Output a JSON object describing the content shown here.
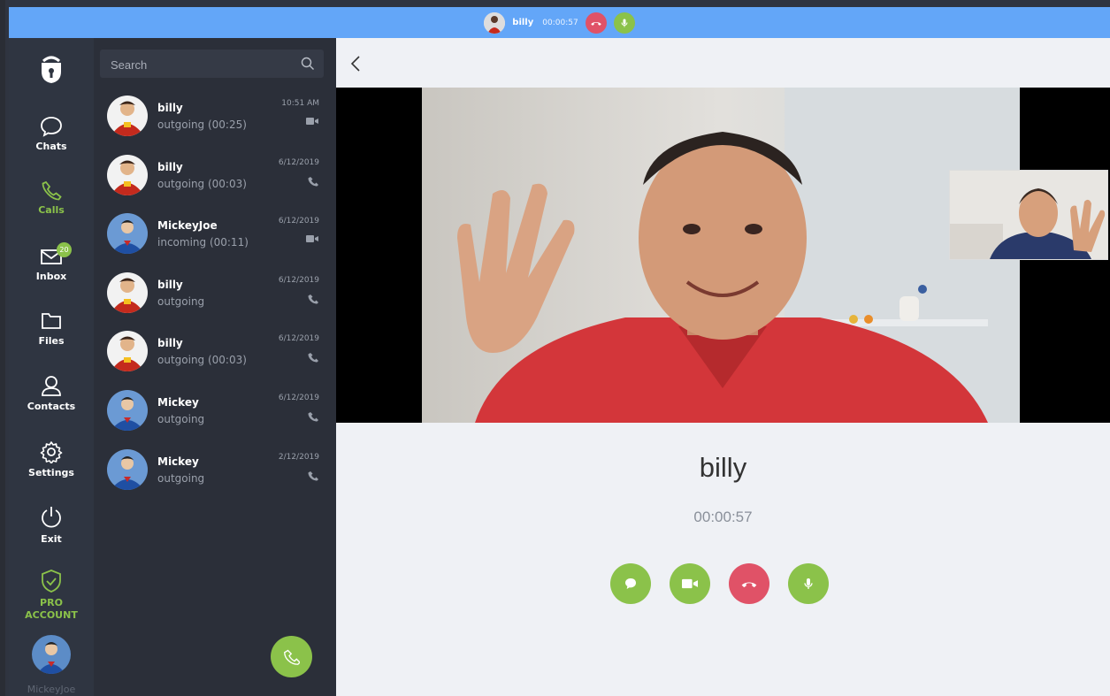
{
  "topbar": {
    "caller_name": "billy",
    "duration": "00:00:57",
    "colors": {
      "bar": "#63a6f8",
      "hangup": "#e05267",
      "mic": "#8bc24a"
    }
  },
  "nav": {
    "items": [
      {
        "label": "Chats",
        "icon": "chat-bubble-icon"
      },
      {
        "label": "Calls",
        "icon": "phone-icon",
        "active": true
      },
      {
        "label": "Inbox",
        "icon": "envelope-icon",
        "badge": "20"
      },
      {
        "label": "Files",
        "icon": "folder-icon"
      },
      {
        "label": "Contacts",
        "icon": "person-icon"
      },
      {
        "label": "Settings",
        "icon": "gear-icon"
      },
      {
        "label": "Exit",
        "icon": "power-icon"
      }
    ],
    "pro_line1": "PRO",
    "pro_line2": "ACCOUNT",
    "user_name": "MickeyJoe"
  },
  "search": {
    "placeholder": "Search"
  },
  "calls": [
    {
      "name": "billy",
      "status": "outgoing (00:25)",
      "date": "10:51 AM",
      "type": "video",
      "avatar": "red-hero"
    },
    {
      "name": "billy",
      "status": "outgoing (00:03)",
      "date": "6/12/2019",
      "type": "voice",
      "avatar": "red-hero"
    },
    {
      "name": "MickeyJoe",
      "status": "incoming (00:11)",
      "date": "6/12/2019",
      "type": "video",
      "avatar": "blue-hero"
    },
    {
      "name": "billy",
      "status": "outgoing",
      "date": "6/12/2019",
      "type": "voice",
      "avatar": "red-hero"
    },
    {
      "name": "billy",
      "status": "outgoing (00:03)",
      "date": "6/12/2019",
      "type": "voice",
      "avatar": "red-hero"
    },
    {
      "name": "Mickey",
      "status": "outgoing",
      "date": "6/12/2019",
      "type": "voice",
      "avatar": "blue-hero"
    },
    {
      "name": "Mickey",
      "status": "outgoing",
      "date": "2/12/2019",
      "type": "voice",
      "avatar": "blue-hero"
    }
  ],
  "call": {
    "callee": "billy",
    "timer": "00:00:57"
  },
  "colors": {
    "accent": "#8bc24a",
    "hangup": "#e05267",
    "sidebar": "#2f3541",
    "list": "#2b2f39",
    "main": "#eff1f5"
  }
}
